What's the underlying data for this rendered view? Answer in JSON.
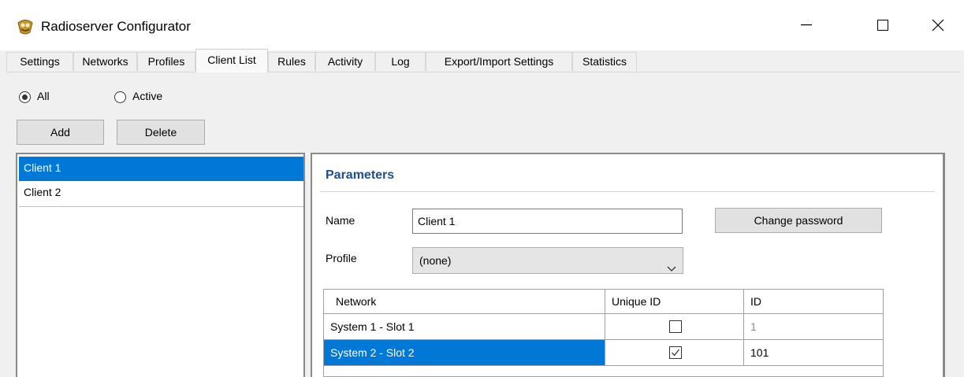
{
  "window": {
    "title": "Radioserver Configurator",
    "icons": {
      "app": "radioserver-app-icon",
      "minimize": "minimize-icon",
      "maximize": "maximize-icon",
      "close": "close-icon"
    }
  },
  "tabs": [
    {
      "label": "Settings",
      "active": false
    },
    {
      "label": "Networks",
      "active": false
    },
    {
      "label": "Profiles",
      "active": false
    },
    {
      "label": "Client List",
      "active": true
    },
    {
      "label": "Rules",
      "active": false
    },
    {
      "label": "Activity",
      "active": false
    },
    {
      "label": "Log",
      "active": false
    },
    {
      "label": "Export/Import Settings",
      "active": false
    },
    {
      "label": "Statistics",
      "active": false
    }
  ],
  "filter": {
    "options": [
      {
        "label": "All",
        "selected": true
      },
      {
        "label": "Active",
        "selected": false
      }
    ]
  },
  "buttons": {
    "add": "Add",
    "delete": "Delete"
  },
  "clients": [
    {
      "name": "Client 1",
      "selected": true
    },
    {
      "name": "Client 2",
      "selected": false
    }
  ],
  "parameters": {
    "title": "Parameters",
    "name_label": "Name",
    "name_value": "Client 1",
    "change_password": "Change password",
    "profile_label": "Profile",
    "profile_value": "(none)",
    "grid": {
      "columns": [
        "Network",
        "Unique ID",
        "ID"
      ],
      "rows": [
        {
          "network": "System 1 - Slot 1",
          "unique_id": false,
          "id": "1",
          "selected": false
        },
        {
          "network": "System 2 - Slot 2",
          "unique_id": true,
          "id": "101",
          "selected": true
        }
      ]
    }
  },
  "colors": {
    "selection": "#0078d7",
    "section_title": "#1f4e8c"
  }
}
